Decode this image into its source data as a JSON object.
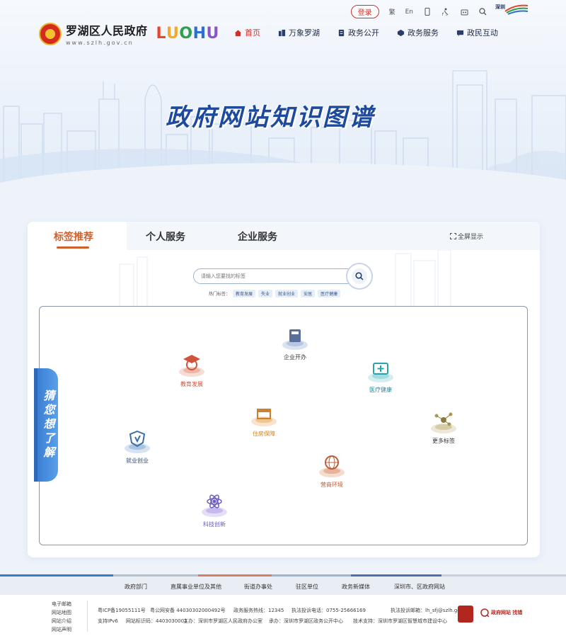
{
  "topbar": {
    "login": "登录",
    "traditional": "繁",
    "english": "En",
    "szlogo_text": "深圳"
  },
  "logo": {
    "name": "罗湖区人民政府",
    "url": "www.szlh.gov.cn",
    "brand": "LUOHU"
  },
  "nav": [
    {
      "label": "首页",
      "icon": "home-icon"
    },
    {
      "label": "万象罗湖",
      "icon": "buildings-icon"
    },
    {
      "label": "政务公开",
      "icon": "document-icon"
    },
    {
      "label": "政务服务",
      "icon": "service-icon"
    },
    {
      "label": "政民互动",
      "icon": "chat-icon"
    }
  ],
  "banner": {
    "title": "政府网站知识图谱"
  },
  "tabs": [
    {
      "label": "标签推荐",
      "active": true
    },
    {
      "label": "个人服务",
      "active": false
    },
    {
      "label": "企业服务",
      "active": false
    }
  ],
  "fullscreen": "全屏显示",
  "search": {
    "placeholder": "请输入您要找的标签"
  },
  "hot": {
    "label": "热门标签：",
    "tags": [
      "教育发展",
      "失业",
      "就业创业",
      "安居",
      "医疗健康"
    ]
  },
  "nodes": [
    {
      "label": "企业开办",
      "color": "#5a6f9a",
      "icon": "box-icon"
    },
    {
      "label": "教育发展",
      "color": "#d0533a",
      "icon": "graduation-icon"
    },
    {
      "label": "医疗健康",
      "color": "#2aa3ac",
      "icon": "medical-kit-icon"
    },
    {
      "label": "住房保障",
      "color": "#d0802a",
      "icon": "shop-icon"
    },
    {
      "label": "更多标签",
      "color": "#8a7a40",
      "icon": "network-icon"
    },
    {
      "label": "就业创业",
      "color": "#3d6ea8",
      "icon": "shield-icon"
    },
    {
      "label": "营商环境",
      "color": "#b8603a",
      "icon": "globe-icon"
    },
    {
      "label": "科技创新",
      "color": "#6b5bc2",
      "icon": "atom-icon"
    }
  ],
  "side_tab": "猜您想了解",
  "footer_links": [
    "政府部门",
    "直属事业单位及其他",
    "街道办事处",
    "驻区单位",
    "政务新媒体",
    "深圳市、区政府网站"
  ],
  "footer_left": [
    "电子邮箱",
    "网站地图",
    "网站介绍",
    "网站声明"
  ],
  "footer_row1": [
    "粤ICP备19055111号",
    "粤公网安备 44030302000492号",
    "政务服务热线：12345",
    "执法投诉电话：0755-25666169",
    "执法投诉邮箱：lh_sfj@szlh.gov.cn"
  ],
  "footer_row2": [
    "支持IPv6",
    "网站标识码：4403030003",
    "主办：深圳市罗湖区人民政府办公室",
    "承办：深圳市罗湖区政务公开中心",
    "技术支持：深圳市罗湖区智慧城市建设中心"
  ],
  "footer_badge2": "政府网站 找错"
}
